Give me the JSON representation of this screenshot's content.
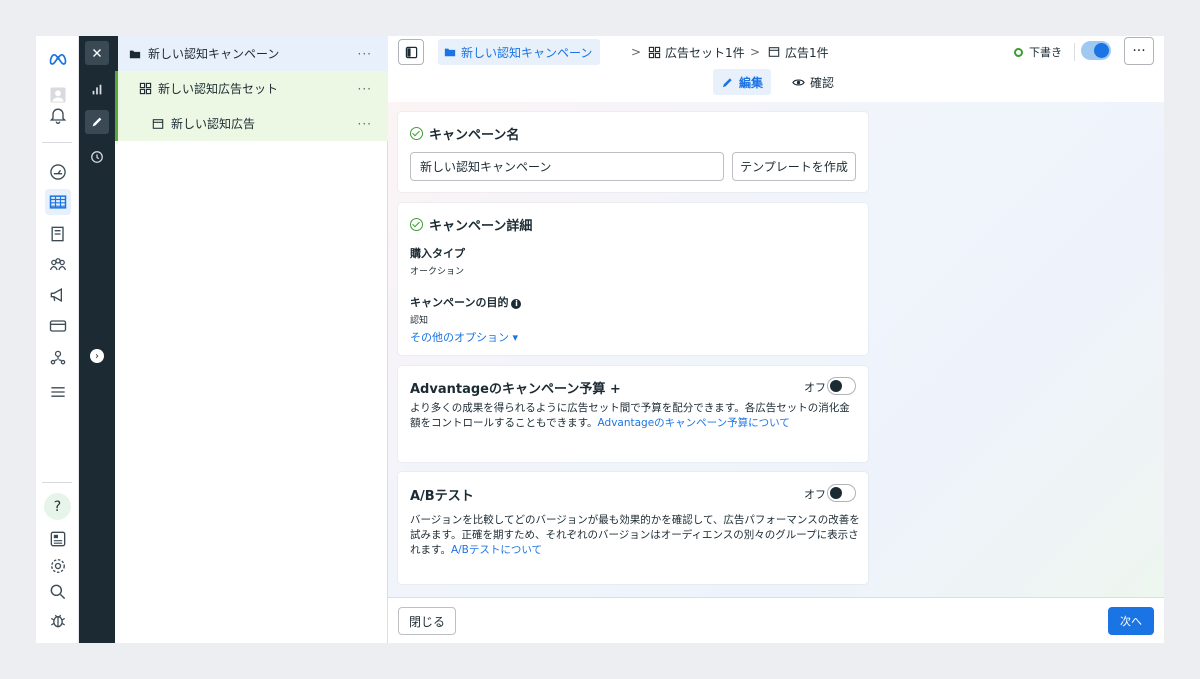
{
  "tree": {
    "campaign": "新しい認知キャンペーン",
    "adset": "新しい認知広告セット",
    "ad": "新しい認知広告",
    "more": "···"
  },
  "breadcrumb": {
    "campaign": "新しい認知キャンペーン",
    "adsets": "広告セット1件",
    "ads": "広告1件",
    "separator": ">"
  },
  "header": {
    "status": "下書き",
    "more": "···",
    "tab_edit": "編集",
    "tab_preview": "確認"
  },
  "campaign_name": {
    "title": "キャンペーン名",
    "value": "新しい認知キャンペーン",
    "template_button": "テンプレートを作成"
  },
  "campaign_details": {
    "title": "キャンペーン詳細",
    "buying_type_label": "購入タイプ",
    "buying_type_value": "オークション",
    "objective_label": "キャンペーンの目的",
    "objective_value": "認知",
    "more_options": "その他のオプション ▾"
  },
  "advantage_budget": {
    "title": "Advantageのキャンペーン予算 +",
    "toggle_label": "オフ",
    "description": "より多くの成果を得られるように広告セット間で予算を配分できます。各広告セットの消化金額をコントロールすることもできます。",
    "link": "Advantageのキャンペーン予算について"
  },
  "ab_test": {
    "title": "A/Bテスト",
    "toggle_label": "オフ",
    "description": "バージョンを比較してどのバージョンが最も効果的かを確認して、広告パフォーマンスの改善を試みます。正確を期すため、それぞれのバージョンはオーディエンスの別々のグループに表示されます。",
    "link": "A/Bテストについて"
  },
  "footer": {
    "close": "閉じる",
    "next": "次へ"
  },
  "rail": {
    "help": "?"
  }
}
